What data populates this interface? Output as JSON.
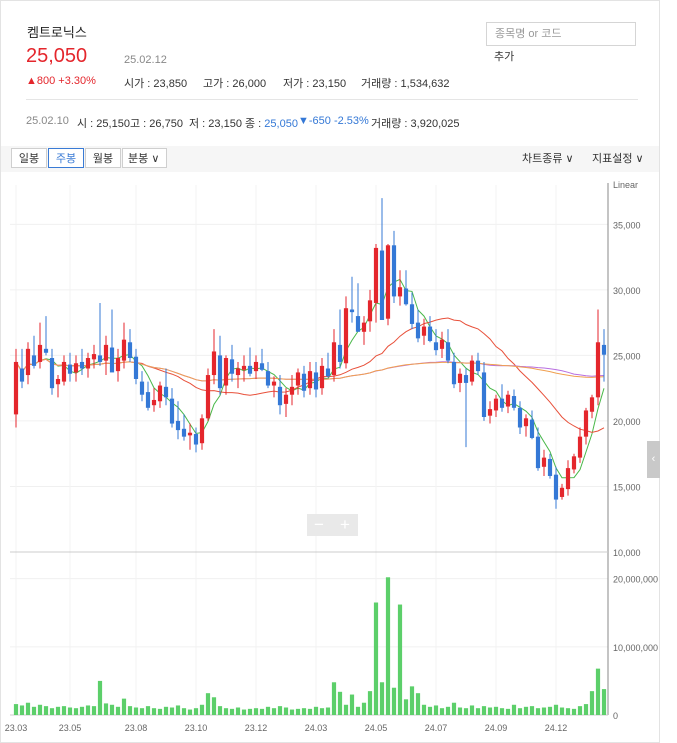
{
  "stock": {
    "name": "켐트로닉스",
    "price": "25,050",
    "date": "25.02.12",
    "change": "▲800 +3.30%",
    "open_label": "시가",
    "open": "23,850",
    "high_label": "고가",
    "high": "26,000",
    "low_label": "저가",
    "low": "23,150",
    "volume_label": "거래량",
    "volume": "1,534,632"
  },
  "search": {
    "placeholder": "종목명 or 코드",
    "add_label": "추가"
  },
  "bar_info": {
    "date": "25.02.10",
    "open_label": "시",
    "open": "25,150",
    "high_label": "고",
    "high": "26,750",
    "low_label": "저",
    "low": "23,150",
    "close_label": "종",
    "close": "25,050",
    "change": "▼-650 -2.53%",
    "volume_label": "거래량",
    "volume": "3,920,025"
  },
  "toolbar": {
    "tabs": [
      "일봉",
      "주봉",
      "월봉",
      "분봉"
    ],
    "active_tab": "주봉",
    "chart_type_label": "차트종류",
    "indicator_label": "지표설정"
  },
  "colors": {
    "up": "#e4262c",
    "down": "#3478d6",
    "ma5": "#49b849",
    "ma20": "#e8503a",
    "ma60": "#b86fe0",
    "ma120": "#f0a050",
    "volume": "#5ccf6a"
  },
  "chart_data": {
    "type": "candlestick",
    "scale_label": "Linear",
    "price_ticks": [
      "35,000",
      "30,000",
      "25,000",
      "20,000",
      "15,000",
      "10,000"
    ],
    "price_tick_values": [
      35000,
      30000,
      25000,
      20000,
      15000,
      10000
    ],
    "volume_ticks": [
      "20,000,000",
      "10,000,000",
      "0"
    ],
    "volume_tick_values": [
      20000000,
      10000000,
      0
    ],
    "x_labels": [
      "23.03",
      "23.05",
      "23.08",
      "23.10",
      "23.12",
      "24.03",
      "24.05",
      "24.07",
      "24.09",
      "24.12"
    ],
    "x_label_index": [
      0,
      9,
      20,
      30,
      40,
      50,
      60,
      70,
      80,
      90
    ],
    "candles": [
      [
        20500,
        25500,
        19500,
        24500
      ],
      [
        24000,
        25500,
        22500,
        23000
      ],
      [
        23500,
        26000,
        22800,
        25500
      ],
      [
        25000,
        26500,
        24000,
        24200
      ],
      [
        24500,
        27500,
        24000,
        25800
      ],
      [
        25500,
        28000,
        25000,
        25200
      ],
      [
        24800,
        25500,
        22000,
        22500
      ],
      [
        22800,
        23500,
        21800,
        23200
      ],
      [
        23000,
        25000,
        22700,
        24500
      ],
      [
        24300,
        25200,
        23000,
        23600
      ],
      [
        23700,
        25000,
        23000,
        24400
      ],
      [
        24500,
        25500,
        23500,
        24000
      ],
      [
        24000,
        25200,
        23300,
        24800
      ],
      [
        24700,
        25800,
        24000,
        25100
      ],
      [
        25000,
        29000,
        24200,
        24500
      ],
      [
        24600,
        26500,
        23500,
        25800
      ],
      [
        25600,
        28500,
        24800,
        23700
      ],
      [
        23800,
        25500,
        23000,
        24800
      ],
      [
        24600,
        27500,
        24000,
        26200
      ],
      [
        26000,
        27000,
        24500,
        24800
      ],
      [
        24900,
        25500,
        22800,
        23200
      ],
      [
        23000,
        23800,
        21500,
        22000
      ],
      [
        22200,
        23000,
        20800,
        21000
      ],
      [
        21200,
        22500,
        20700,
        21600
      ],
      [
        21500,
        23000,
        21000,
        22700
      ],
      [
        22600,
        24000,
        21200,
        21800
      ],
      [
        21700,
        22500,
        19500,
        19800
      ],
      [
        20000,
        21500,
        18600,
        19300
      ],
      [
        19400,
        20500,
        18500,
        18800
      ],
      [
        18900,
        19800,
        17800,
        19100
      ],
      [
        19000,
        19500,
        17600,
        18200
      ],
      [
        18300,
        20500,
        17800,
        20200
      ],
      [
        20200,
        24000,
        20000,
        23500
      ],
      [
        23500,
        27000,
        22800,
        25300
      ],
      [
        25000,
        26500,
        22000,
        22500
      ],
      [
        22700,
        25000,
        22000,
        24800
      ],
      [
        24700,
        25800,
        23000,
        23600
      ],
      [
        23500,
        24500,
        22500,
        24000
      ],
      [
        23900,
        25000,
        23000,
        24200
      ],
      [
        24200,
        25600,
        23400,
        23600
      ],
      [
        23800,
        25000,
        23200,
        24500
      ],
      [
        24400,
        25500,
        23800,
        23900
      ],
      [
        23800,
        24500,
        22500,
        22700
      ],
      [
        22700,
        23400,
        21800,
        23000
      ],
      [
        22600,
        23500,
        20500,
        21200
      ],
      [
        21300,
        22500,
        20300,
        22000
      ],
      [
        22000,
        23500,
        21200,
        22600
      ],
      [
        22700,
        24000,
        22000,
        23700
      ],
      [
        23600,
        24200,
        21800,
        22300
      ],
      [
        22500,
        24500,
        22000,
        23800
      ],
      [
        23700,
        24500,
        21800,
        22400
      ],
      [
        22500,
        24800,
        22000,
        24200
      ],
      [
        24000,
        25200,
        23300,
        23400
      ],
      [
        23500,
        27000,
        23000,
        26000
      ],
      [
        25800,
        28500,
        24000,
        24500
      ],
      [
        24400,
        29500,
        24000,
        28600
      ],
      [
        28500,
        31000,
        27500,
        28300
      ],
      [
        28000,
        30500,
        27000,
        26800
      ],
      [
        26800,
        28000,
        25800,
        27500
      ],
      [
        27600,
        30000,
        26800,
        29200
      ],
      [
        29000,
        33500,
        27500,
        33200
      ],
      [
        33000,
        37000,
        28000,
        27700
      ],
      [
        27800,
        33500,
        27300,
        33400
      ],
      [
        33400,
        34500,
        29000,
        29500
      ],
      [
        29500,
        31500,
        28800,
        30200
      ],
      [
        30100,
        31500,
        28800,
        28900
      ],
      [
        28900,
        29800,
        27000,
        27400
      ],
      [
        27500,
        28500,
        26000,
        26300
      ],
      [
        26500,
        27800,
        25800,
        27200
      ],
      [
        27200,
        28000,
        26000,
        26100
      ],
      [
        26000,
        27000,
        25000,
        25400
      ],
      [
        25500,
        26800,
        24800,
        26200
      ],
      [
        26000,
        27000,
        24400,
        24600
      ],
      [
        24500,
        25200,
        22500,
        22800
      ],
      [
        22900,
        24000,
        22200,
        23600
      ],
      [
        23500,
        24000,
        18000,
        22900
      ],
      [
        23000,
        25000,
        22700,
        24600
      ],
      [
        24600,
        25200,
        23500,
        23800
      ],
      [
        23700,
        24500,
        20000,
        20300
      ],
      [
        20400,
        21500,
        19800,
        20900
      ],
      [
        20800,
        22000,
        20300,
        21700
      ],
      [
        21700,
        22800,
        20700,
        21000
      ],
      [
        21100,
        22300,
        20600,
        22000
      ],
      [
        21900,
        22400,
        20800,
        21000
      ],
      [
        21000,
        21500,
        19000,
        19500
      ],
      [
        19600,
        20500,
        18800,
        20200
      ],
      [
        20100,
        20800,
        18600,
        18700
      ],
      [
        18800,
        19500,
        16200,
        16400
      ],
      [
        16500,
        17800,
        15800,
        17200
      ],
      [
        17100,
        17500,
        15600,
        15800
      ],
      [
        15900,
        16500,
        13300,
        14000
      ],
      [
        14200,
        15200,
        14000,
        14900
      ],
      [
        14800,
        17000,
        14300,
        16400
      ],
      [
        16300,
        17500,
        16000,
        17300
      ],
      [
        17200,
        19500,
        16800,
        18800
      ],
      [
        18800,
        21000,
        18200,
        20800
      ],
      [
        20700,
        22000,
        20200,
        21800
      ],
      [
        21800,
        28500,
        21200,
        26000
      ],
      [
        25800,
        27000,
        23000,
        25050
      ]
    ],
    "volumes": [
      1.6,
      1.4,
      1.8,
      1.2,
      1.5,
      1.3,
      1.0,
      1.2,
      1.3,
      1.1,
      1.0,
      1.2,
      1.4,
      1.3,
      5.0,
      1.7,
      1.5,
      1.2,
      2.4,
      1.3,
      1.1,
      1.0,
      1.3,
      1.0,
      0.9,
      1.2,
      1.1,
      1.4,
      1.0,
      0.8,
      1.0,
      1.5,
      3.2,
      2.6,
      1.3,
      1.0,
      0.9,
      1.1,
      0.8,
      0.9,
      1.0,
      0.9,
      1.2,
      1.0,
      1.3,
      1.1,
      0.8,
      0.9,
      1.0,
      0.9,
      1.2,
      1.0,
      1.1,
      4.8,
      3.4,
      1.5,
      3.0,
      1.2,
      1.8,
      3.5,
      16.5,
      4.8,
      20.2,
      4.0,
      16.2,
      2.3,
      4.2,
      3.2,
      1.5,
      1.2,
      1.4,
      1.0,
      1.2,
      1.8,
      1.1,
      1.0,
      1.4,
      1.0,
      1.3,
      1.1,
      1.2,
      1.0,
      0.9,
      1.5,
      1.0,
      1.2,
      1.3,
      1.0,
      1.1,
      1.2,
      1.5,
      1.1,
      1.0,
      0.9,
      1.3,
      1.6,
      3.5,
      6.8,
      3.8
    ]
  }
}
